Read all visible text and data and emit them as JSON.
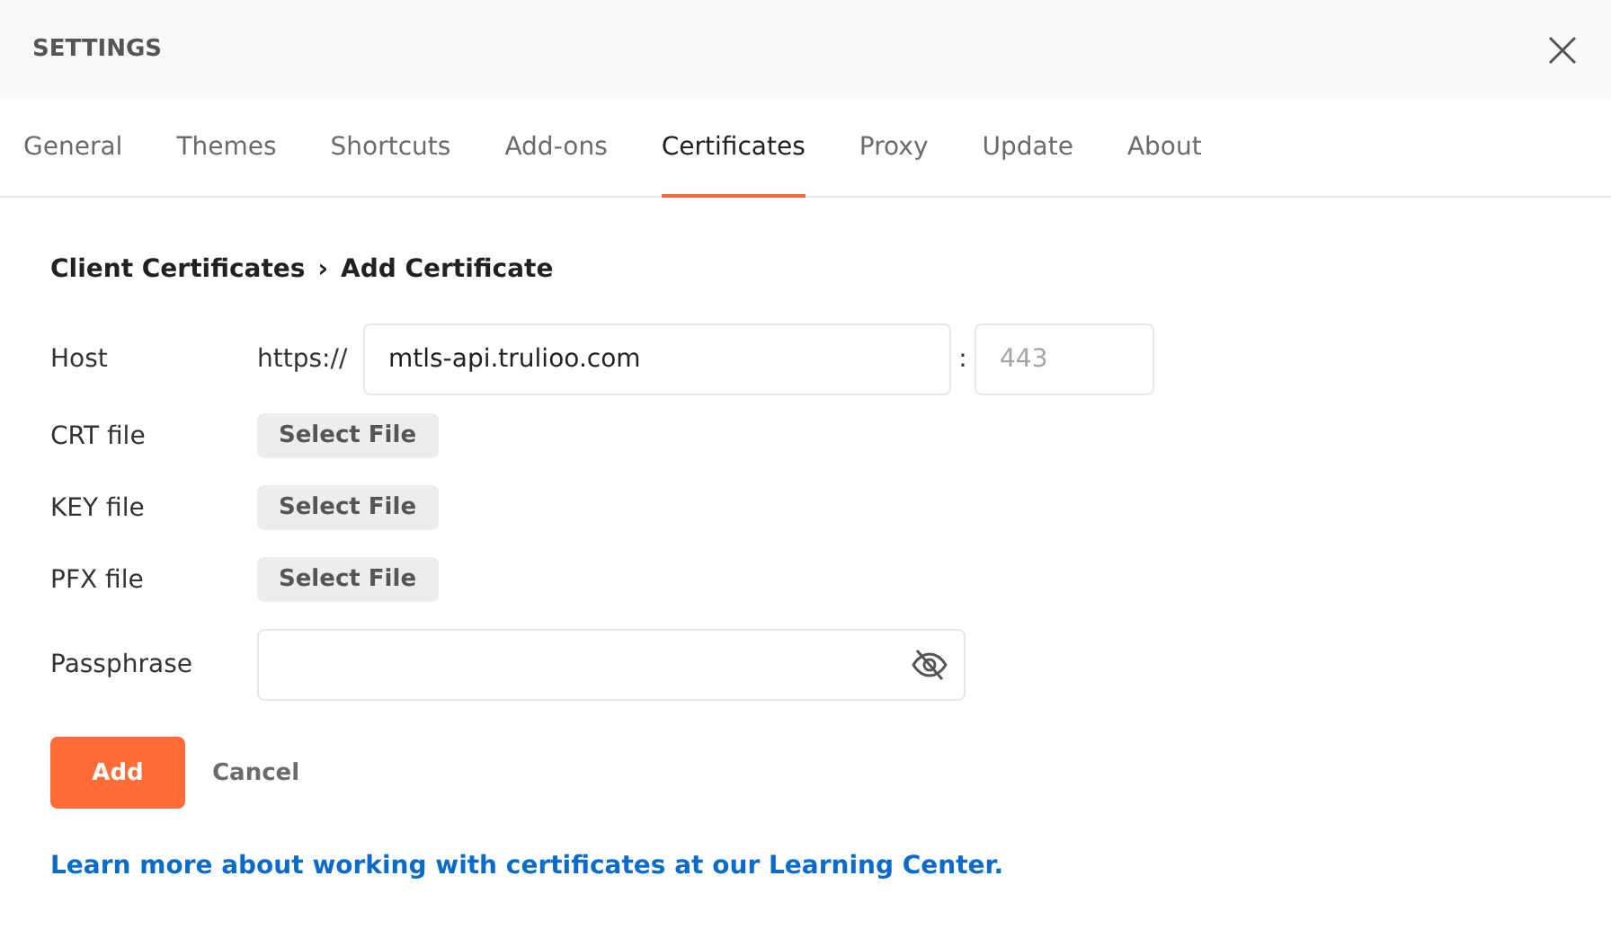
{
  "window": {
    "title": "SETTINGS"
  },
  "tabs": [
    {
      "label": "General",
      "selected": false
    },
    {
      "label": "Themes",
      "selected": false
    },
    {
      "label": "Shortcuts",
      "selected": false
    },
    {
      "label": "Add-ons",
      "selected": false
    },
    {
      "label": "Certificates",
      "selected": true
    },
    {
      "label": "Proxy",
      "selected": false
    },
    {
      "label": "Update",
      "selected": false
    },
    {
      "label": "About",
      "selected": false
    }
  ],
  "breadcrumb": {
    "parent": "Client Certificates",
    "separator": "›",
    "current": "Add Certificate"
  },
  "form": [
    {
      "kind": "host",
      "label": "Host",
      "prefix": "https://",
      "value": "mtls-api.trulioo.com",
      "separator": ":",
      "port_placeholder": "443"
    },
    {
      "kind": "file",
      "label": "CRT file",
      "button": "Select File"
    },
    {
      "kind": "file",
      "label": "KEY file",
      "button": "Select File"
    },
    {
      "kind": "file",
      "label": "PFX file",
      "button": "Select File"
    },
    {
      "kind": "password",
      "label": "Passphrase"
    }
  ],
  "actions": {
    "primary": "Add",
    "secondary": "Cancel"
  },
  "link": "Learn more about working with certificates at our Learning Center."
}
